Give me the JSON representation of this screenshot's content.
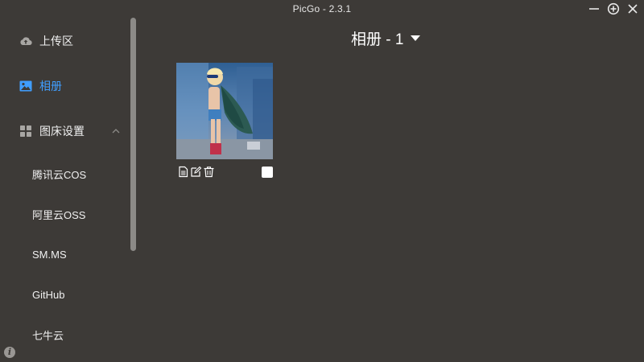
{
  "window": {
    "title": "PicGo - 2.3.1",
    "controls": [
      "minimize-icon",
      "pin-icon",
      "close-icon"
    ]
  },
  "sidebar": {
    "items": [
      {
        "label": "上传区",
        "icon": "cloud-upload-icon",
        "active": false
      },
      {
        "label": "相册",
        "icon": "image-icon",
        "active": true
      },
      {
        "label": "图床设置",
        "icon": "grid-icon",
        "active": false,
        "expanded": true
      }
    ],
    "sub_items": [
      {
        "label": "腾讯云COS"
      },
      {
        "label": "阿里云OSS"
      },
      {
        "label": "SM.MS"
      },
      {
        "label": "GitHub"
      },
      {
        "label": "七牛云"
      }
    ],
    "info_icon": "i"
  },
  "gallery": {
    "title": "相册 - 1",
    "images": [
      {
        "alt": "child in superhero cape",
        "actions": [
          "copy-icon",
          "edit-icon",
          "delete-icon"
        ],
        "checked": false
      }
    ]
  },
  "colors": {
    "background": "#3d3a37",
    "accent": "#409eff",
    "text": "#ffffff"
  }
}
